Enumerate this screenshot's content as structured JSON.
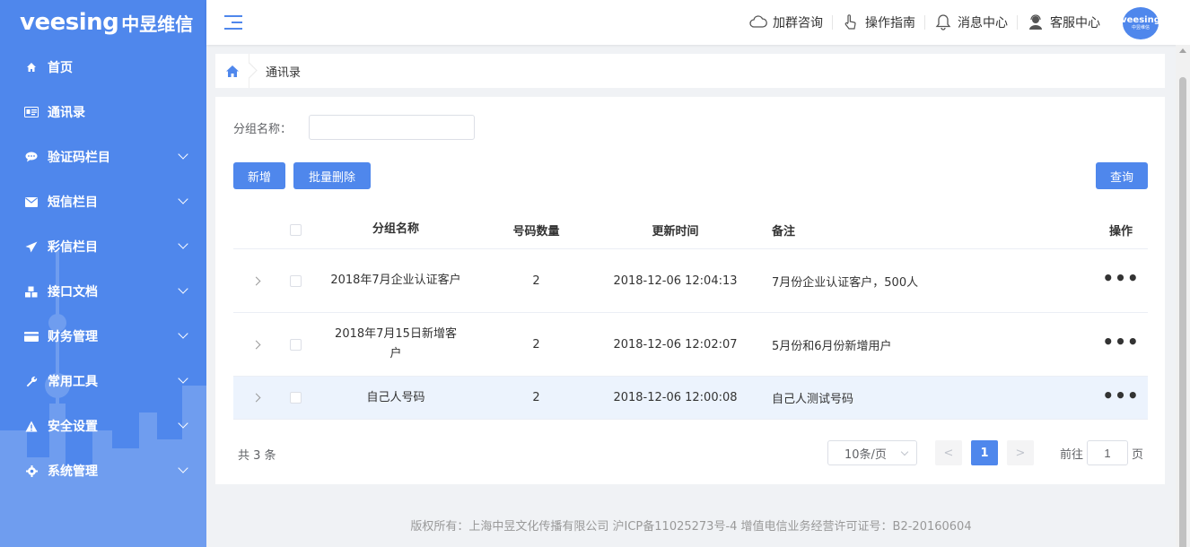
{
  "colors": {
    "primary": "#4f87ec",
    "sidebar_bg": "#4f87ec",
    "row_highlight": "#ecf3fd"
  },
  "logo": {
    "brand": "veesing",
    "cn": "中昱维信"
  },
  "sidebar": {
    "items": [
      {
        "label": "首页",
        "icon": "home-icon",
        "expandable": false
      },
      {
        "label": "通讯录",
        "icon": "address-book-icon",
        "expandable": false
      },
      {
        "label": "验证码栏目",
        "icon": "chat-bubble-icon",
        "expandable": true
      },
      {
        "label": "短信栏目",
        "icon": "envelope-icon",
        "expandable": true
      },
      {
        "label": "彩信栏目",
        "icon": "paper-plane-icon",
        "expandable": true
      },
      {
        "label": "接口文档",
        "icon": "cubes-icon",
        "expandable": true
      },
      {
        "label": "财务管理",
        "icon": "credit-card-icon",
        "expandable": true
      },
      {
        "label": "常用工具",
        "icon": "wrench-icon",
        "expandable": true
      },
      {
        "label": "安全设置",
        "icon": "warning-icon",
        "expandable": true
      },
      {
        "label": "系统管理",
        "icon": "gear-icon",
        "expandable": true
      }
    ]
  },
  "header": {
    "links": [
      {
        "label": "加群咨询",
        "icon": "cloud-icon"
      },
      {
        "label": "操作指南",
        "icon": "hand-pointer-icon"
      },
      {
        "label": "消息中心",
        "icon": "bell-icon"
      },
      {
        "label": "客服中心",
        "icon": "support-agent-icon"
      }
    ],
    "avatar_text": "veesing",
    "avatar_sub": "中昱维信"
  },
  "breadcrumb": {
    "current": "通讯录"
  },
  "filter": {
    "label": "分组名称：",
    "value": "",
    "placeholder": ""
  },
  "buttons": {
    "add": "新增",
    "batch_delete": "批量删除",
    "query": "查询"
  },
  "table": {
    "columns": {
      "name": "分组名称",
      "count": "号码数量",
      "updated": "更新时间",
      "note": "备注",
      "ops": "操作"
    },
    "rows": [
      {
        "name": "2018年7月企业认证客户",
        "count": "2",
        "updated": "2018-12-06 12:04:13",
        "note": "7月份企业认证客户，500人",
        "ops": "•••"
      },
      {
        "name": "2018年7月15日新增客户",
        "count": "2",
        "updated": "2018-12-06 12:02:07",
        "note": "5月份和6月份新增用户",
        "ops": "•••"
      },
      {
        "name": "自己人号码",
        "count": "2",
        "updated": "2018-12-06 12:00:08",
        "note": "自己人测试号码",
        "ops": "•••"
      }
    ]
  },
  "pagination": {
    "total": "共 3 条",
    "page_size": "10条/页",
    "current_page": "1",
    "prev": "<",
    "next": ">",
    "goto_prefix": "前往",
    "goto_value": "1",
    "goto_suffix": "页"
  },
  "footer": {
    "text": "版权所有：上海中昱文化传播有限公司 沪ICP备11025273号-4 增值电信业务经营许可证号：B2-20160604"
  }
}
